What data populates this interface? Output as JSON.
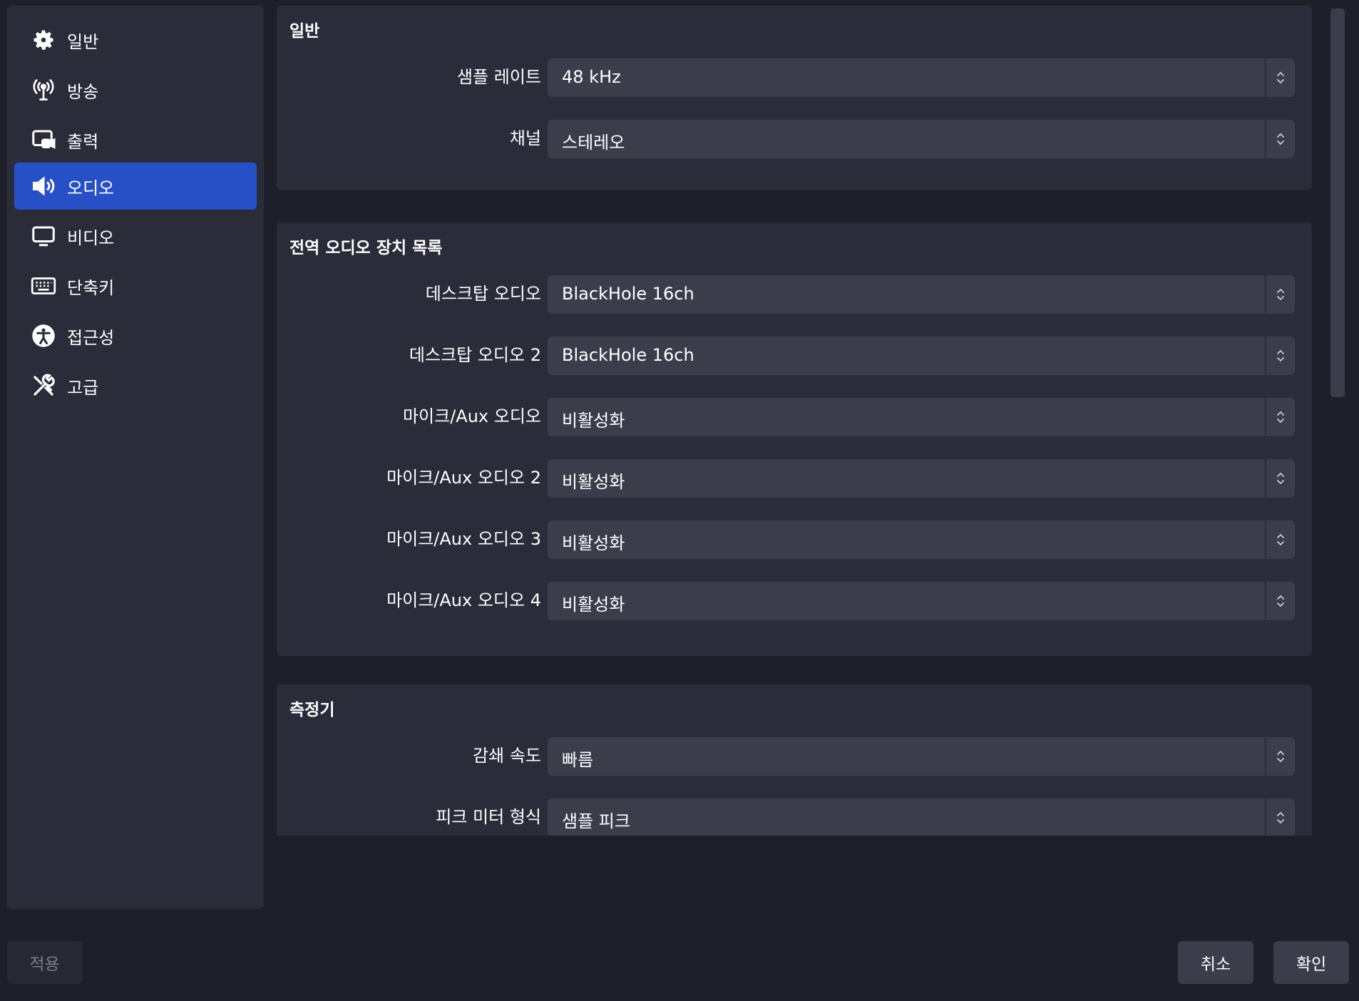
{
  "sidebar": {
    "items": [
      {
        "label": "일반",
        "icon": "gear-icon"
      },
      {
        "label": "방송",
        "icon": "antenna-icon"
      },
      {
        "label": "출력",
        "icon": "output-icon"
      },
      {
        "label": "오디오",
        "icon": "speaker-icon",
        "active": true
      },
      {
        "label": "비디오",
        "icon": "monitor-icon"
      },
      {
        "label": "단축키",
        "icon": "keyboard-icon"
      },
      {
        "label": "접근성",
        "icon": "accessibility-icon"
      },
      {
        "label": "고급",
        "icon": "tools-icon"
      }
    ]
  },
  "general": {
    "title": "일반",
    "sample_rate": {
      "label": "샘플 레이트",
      "value": "48 kHz"
    },
    "channels": {
      "label": "채널",
      "value": "스테레오"
    }
  },
  "devices": {
    "title": "전역 오디오 장치 목록",
    "rows": [
      {
        "label": "데스크탑 오디오",
        "value": "BlackHole 16ch"
      },
      {
        "label": "데스크탑 오디오 2",
        "value": "BlackHole 16ch"
      },
      {
        "label": "마이크/Aux 오디오",
        "value": "비활성화"
      },
      {
        "label": "마이크/Aux 오디오 2",
        "value": "비활성화"
      },
      {
        "label": "마이크/Aux 오디오 3",
        "value": "비활성화"
      },
      {
        "label": "마이크/Aux 오디오 4",
        "value": "비활성화"
      }
    ]
  },
  "meters": {
    "title": "측정기",
    "decay_rate": {
      "label": "감쇄 속도",
      "value": "빠름"
    },
    "peak_meter_type": {
      "label": "피크 미터 형식",
      "value": "샘플 피크"
    }
  },
  "footer": {
    "apply_label": "적용",
    "cancel_label": "취소",
    "ok_label": "확인"
  },
  "colors": {
    "background": "#1e1f28",
    "panel": "#2a2c39",
    "control": "#3b3d4b",
    "accent": "#2850c6"
  }
}
